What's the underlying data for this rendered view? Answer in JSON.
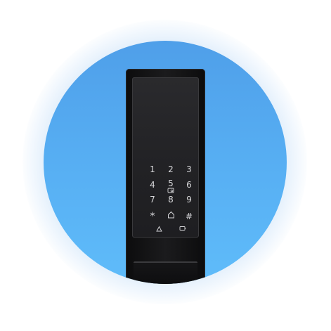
{
  "product": {
    "name": "smart-door-lock",
    "keypad": {
      "rows": [
        [
          "1",
          "2",
          "3"
        ],
        [
          "4",
          "5",
          "6"
        ],
        [
          "7",
          "8",
          "9"
        ]
      ],
      "bottom_row": [
        "*",
        "home-icon",
        "#"
      ],
      "function_keys": [
        "lock-icon",
        "card-icon"
      ],
      "fingerprint_reader": "fingerprint-sensor-icon"
    }
  },
  "colors": {
    "background": "#ffffff",
    "circle_top": "#4f9fe9",
    "circle_bottom": "#5fbcfa",
    "lock_body": "#121214",
    "key_glow": "#d7d7da"
  }
}
